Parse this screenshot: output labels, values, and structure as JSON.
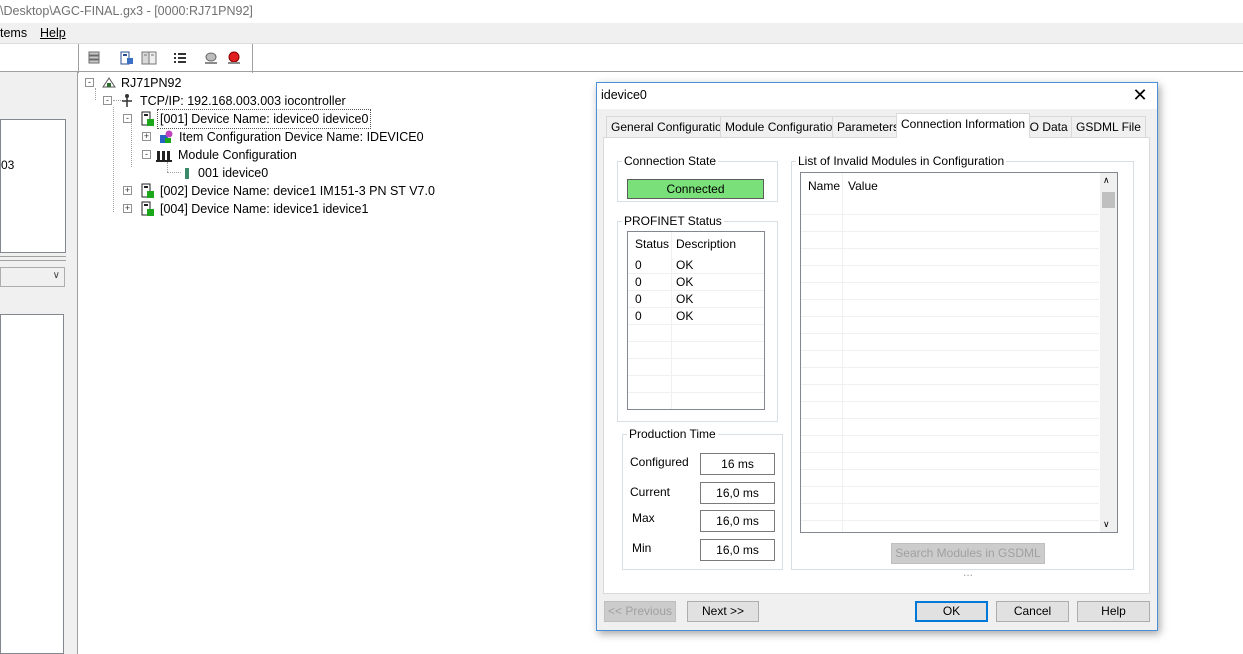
{
  "window": {
    "title": "\\Desktop\\AGC-FINAL.gx3 - [0000:RJ71PN92]"
  },
  "menu": {
    "items_label": "tems",
    "help_label": "Help"
  },
  "left_pane": {
    "partial_text": "03"
  },
  "tree": {
    "root": "RJ71PN92",
    "tcp": "TCP/IP: 192.168.003.003  iocontroller",
    "dev001": "[001] Device Name: idevice0   idevice0",
    "item_config": "Item Configuration  Device Name: IDEVICE0",
    "module_config": "Module Configuration",
    "module_001": "001 idevice0",
    "dev002": "[002] Device Name: device1   IM151-3 PN ST V7.0",
    "dev004": "[004] Device Name: idevice1   idevice1"
  },
  "dialog": {
    "title": "idevice0",
    "close": "✕",
    "tabs": [
      "General Configuration",
      "Module Configuration",
      "Parameters",
      "Connection Information",
      "I/O Data",
      "GSDML File"
    ],
    "active_tab": "Connection Information",
    "connection_state": {
      "legend": "Connection State",
      "value": "Connected",
      "color": "#7ae07a"
    },
    "profinet_status": {
      "legend": "PROFINET Status",
      "headers": [
        "Status",
        "Description"
      ],
      "rows": [
        [
          "0",
          "OK"
        ],
        [
          "0",
          "OK"
        ],
        [
          "0",
          "OK"
        ],
        [
          "0",
          "OK"
        ]
      ]
    },
    "production_time": {
      "legend": "Production Time",
      "rows": [
        {
          "label": "Configured",
          "value": "16 ms"
        },
        {
          "label": "Current",
          "value": "16,0 ms"
        },
        {
          "label": "Max",
          "value": "16,0 ms"
        },
        {
          "label": "Min",
          "value": "16,0 ms"
        }
      ]
    },
    "invalid_modules": {
      "legend": "List of Invalid Modules in Configuration",
      "headers": [
        "Name",
        "Value"
      ],
      "search_button": "Search Modules in GSDML ..."
    },
    "buttons": {
      "previous": "<< Previous",
      "next": "Next >>",
      "ok": "OK",
      "cancel": "Cancel",
      "help": "Help"
    }
  }
}
